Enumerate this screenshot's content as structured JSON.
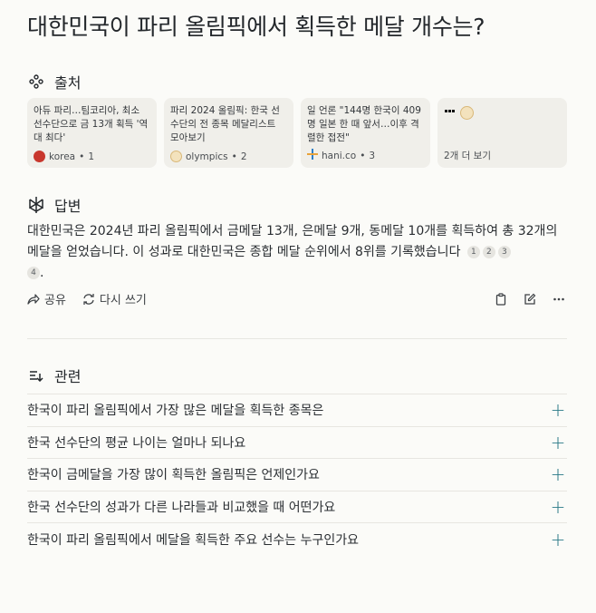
{
  "title": "대한민국이 파리 올림픽에서 획득한 메달 개수는?",
  "sources_heading": "출처",
  "sources": [
    {
      "text": "아듀 파리…팀코리아, 최소 선수단으로 금 13개 획득 '역대 최다'",
      "site": "korea",
      "num": "1",
      "fav_color": "#c8372d"
    },
    {
      "text": "파리 2024 올림픽: 한국 선수단의 전 종목 메달리스트 모아보기",
      "site": "olympics",
      "num": "2",
      "fav_color": "#e8c890"
    },
    {
      "text": "일 언론 \"144명 한국이 409명 일본 한 때 앞서…이후 격렬한 접전\"",
      "site": "hani.co",
      "num": "3",
      "fav_color": "#2d7fc8"
    }
  ],
  "more_sources": "2개 더 보기",
  "answer_heading": "답변",
  "answer_text": "대한민국은 2024년 파리 올림픽에서 금메달 13개, 은메달 9개, 동메달 10개를 획득하여 총 32개의 메달을 얻었습니다. 이 성과로 대한민국은 종합 메달 순위에서 8위를 기록했습니다",
  "citations": [
    "1",
    "2",
    "3",
    "4"
  ],
  "actions": {
    "share": "공유",
    "rewrite": "다시 쓰기"
  },
  "related_heading": "관련",
  "related": [
    "한국이 파리 올림픽에서 가장 많은 메달을 획득한 종목은",
    "한국 선수단의 평균 나이는 얼마나 되나요",
    "한국이 금메달을 가장 많이 획득한 올림픽은 언제인가요",
    "한국 선수단의 성과가 다른 나라들과 비교했을 때 어떤가요",
    "한국이 파리 올림픽에서 메달을 획득한 주요 선수는 누구인가요"
  ],
  "colors": {
    "accent": "#2a7a87",
    "background": "#fbfbf8",
    "card": "#f0efea"
  }
}
